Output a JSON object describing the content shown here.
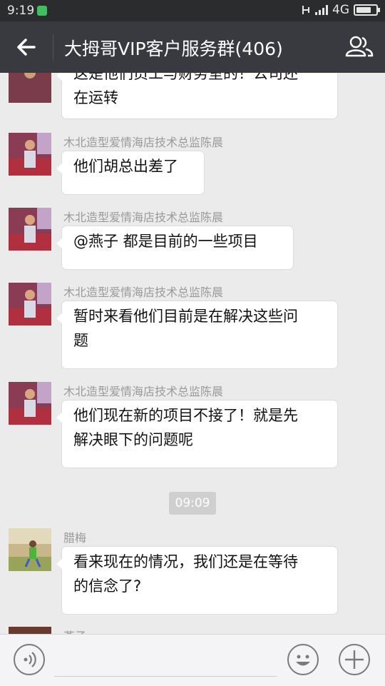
{
  "status": {
    "time": "9:19",
    "network": "4G",
    "icons": [
      "app-notification-icon",
      "mute-icon",
      "signal-icon",
      "battery-icon"
    ]
  },
  "header": {
    "title": "大拇哥VIP客户服务群(406)"
  },
  "messages": [
    {
      "sender": "",
      "text_lines": [
        "这是他们员工与财务室的！公司还",
        "在运转"
      ],
      "avatar": "person-photo-avatar"
    },
    {
      "sender": "木北造型爱情海店技术总监陈晨",
      "text_lines": [
        "他们胡总出差了"
      ],
      "avatar": "person-photo-avatar"
    },
    {
      "sender": "木北造型爱情海店技术总监陈晨",
      "text_lines": [
        "@燕子 都是目前的一些项目"
      ],
      "avatar": "person-photo-avatar"
    },
    {
      "sender": "木北造型爱情海店技术总监陈晨",
      "text_lines": [
        "暂时来看他们目前是在解决这些问",
        "题"
      ],
      "avatar": "person-photo-avatar"
    },
    {
      "sender": "木北造型爱情海店技术总监陈晨",
      "text_lines": [
        "他们现在新的项目不接了！就是先",
        "解决眼下的问题呢"
      ],
      "avatar": "person-photo-avatar"
    },
    {
      "sender": "腊梅",
      "text_lines": [
        "看来现在的情况，我们还是在等待",
        "的信念了?"
      ],
      "avatar": "outdoor-photo-avatar"
    },
    {
      "sender": "燕子",
      "text_lines": [],
      "avatar": "person-photo-avatar"
    }
  ],
  "timestamp": "09:09",
  "colors": {
    "header_bg": "#393a3f",
    "status_bg": "#2b2c2e",
    "chat_bg": "#ebebeb",
    "bubble_bg": "#ffffff"
  }
}
